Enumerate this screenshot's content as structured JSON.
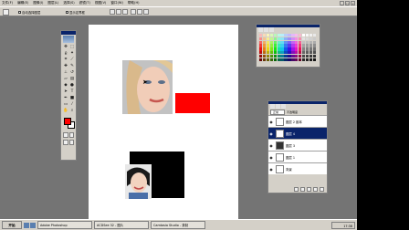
{
  "menubar": {
    "items": [
      "文件(F)",
      "编辑(E)",
      "图像(I)",
      "图层(L)",
      "选择(S)",
      "滤镜(T)",
      "视图(V)",
      "窗口(W)",
      "帮助(H)"
    ]
  },
  "options": {
    "auto_select_layer": "自动选择图层",
    "show_bounds": "显示定界框"
  },
  "colors": {
    "foreground": "#ff0000",
    "background": "#ffffff",
    "canvas": "#ffffff",
    "red_rect": "#ff0000",
    "black_rect": "#000000"
  },
  "toolbox": {
    "icons": [
      "move-icon",
      "marquee-icon",
      "lasso-icon",
      "magic-wand-icon",
      "crop-icon",
      "slice-icon",
      "healing-icon",
      "brush-icon",
      "stamp-icon",
      "history-brush-icon",
      "eraser-icon",
      "gradient-icon",
      "blur-icon",
      "dodge-icon",
      "path-select-icon",
      "type-icon",
      "pen-icon",
      "shape-icon",
      "notes-icon",
      "eyedropper-icon",
      "hand-icon",
      "zoom-icon"
    ]
  },
  "layers": {
    "blend_mode": "正常",
    "opacity_label": "不透明度",
    "rows": [
      {
        "name": "图层 2 副本",
        "active": false,
        "dark": false
      },
      {
        "name": "图层 4",
        "active": true,
        "dark": false
      },
      {
        "name": "图层 3",
        "active": false,
        "dark": true
      },
      {
        "name": "图层 1",
        "active": false,
        "dark": false
      },
      {
        "name": "背景",
        "active": false,
        "dark": false
      }
    ]
  },
  "taskbar": {
    "start": "开始",
    "tasks": [
      "Adobe Photoshop",
      "ACDSee 32 - 图片",
      "Camtasia Studio - 录制"
    ],
    "clock": "17:38"
  }
}
